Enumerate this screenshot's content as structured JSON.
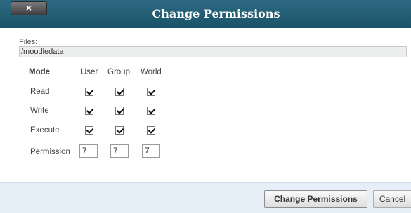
{
  "dialog": {
    "title": "Change Permissions",
    "close_label": "×"
  },
  "files": {
    "label": "Files:",
    "path": "/moodledata"
  },
  "table": {
    "headers": {
      "mode": "Mode",
      "user": "User",
      "group": "Group",
      "world": "World"
    },
    "rows": [
      {
        "label": "Read",
        "user": true,
        "group": true,
        "world": true
      },
      {
        "label": "Write",
        "user": true,
        "group": true,
        "world": true
      },
      {
        "label": "Execute",
        "user": true,
        "group": true,
        "world": true
      }
    ],
    "permission": {
      "label": "Permission",
      "user": "7",
      "group": "7",
      "world": "7"
    }
  },
  "footer": {
    "primary_label": "Change Permissions",
    "cancel_label": "Cancel"
  }
}
